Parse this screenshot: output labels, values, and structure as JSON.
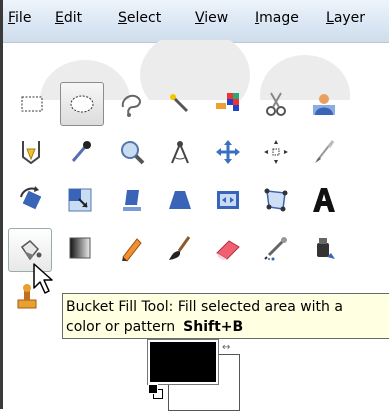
{
  "menu": [
    {
      "mnemonic": "F",
      "rest": "ile"
    },
    {
      "mnemonic": "E",
      "rest": "dit"
    },
    {
      "mnemonic": "S",
      "rest": "elect"
    },
    {
      "mnemonic": "V",
      "rest": "iew"
    },
    {
      "mnemonic": "I",
      "rest": "mage"
    },
    {
      "mnemonic": "L",
      "rest": "ayer"
    }
  ],
  "tooltip": {
    "line1": "Bucket Fill Tool: Fill selected area with a",
    "line2": "color or pattern",
    "shortcut": "Shift+B"
  },
  "colors": {
    "foreground": "#000000",
    "background": "#ffffff"
  },
  "tools": [
    "rectangle-select-icon",
    "ellipse-select-icon",
    "free-select-icon",
    "fuzzy-select-icon",
    "select-by-color-icon",
    "scissors-select-icon",
    "foreground-select-icon",
    "paths-icon",
    "color-picker-icon",
    "zoom-icon",
    "measure-icon",
    "move-icon",
    "alignment-icon",
    "crop-icon",
    "rotate-icon",
    "scale-icon",
    "shear-icon",
    "perspective-icon",
    "flip-icon",
    "cage-transform-icon",
    "text-icon",
    "bucket-fill-icon",
    "blend-icon",
    "pencil-icon",
    "paintbrush-icon",
    "eraser-icon",
    "airbrush-icon",
    "ink-icon",
    "clone-icon"
  ]
}
